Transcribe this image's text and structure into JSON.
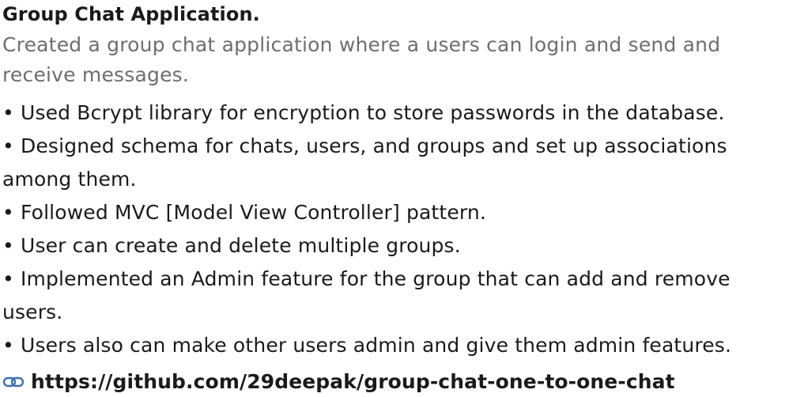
{
  "project": {
    "title": "Group Chat Application.",
    "description": "Created a group chat application where a users can login and send and receive messages.",
    "bullets": [
      "• Used Bcrypt library for encryption to store passwords in the database.",
      "• Designed schema for chats, users, and groups and set up associations among them.",
      "• Followed MVC [Model View Controller] pattern.",
      "• User can create and delete multiple groups.",
      "• Implemented an Admin feature for the group that can add and remove users.",
      "• Users also can make other users admin and give them admin features."
    ],
    "link": {
      "icon": "link-icon",
      "text": "https://github.com/29deepak/group-chat-one-to-one-chat",
      "color": "#3b6fb5"
    }
  }
}
